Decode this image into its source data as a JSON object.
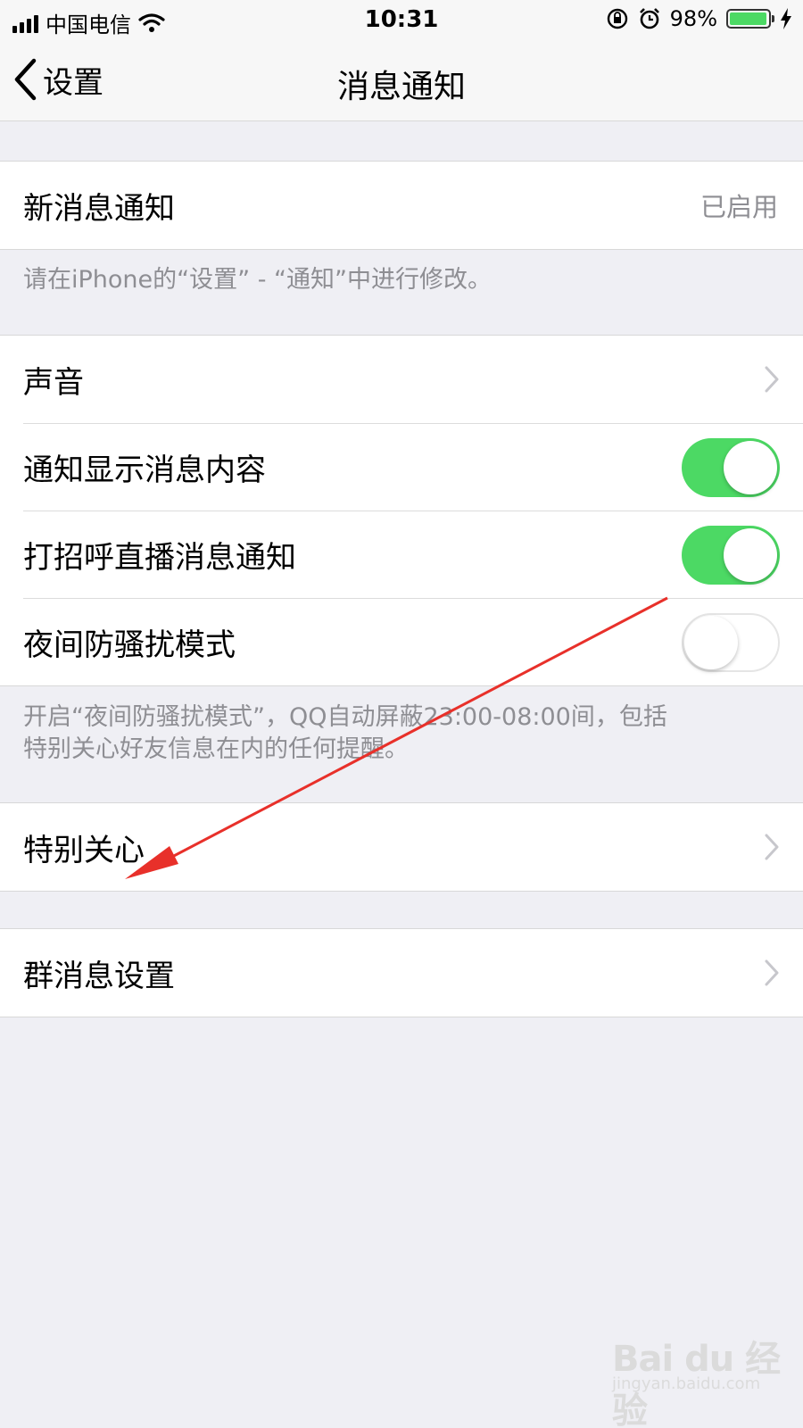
{
  "status_bar": {
    "carrier": "中国电信",
    "time": "10:31",
    "battery_percent": "98%",
    "battery_level": 0.98,
    "colors": {
      "battery_fill": "#4cd964"
    }
  },
  "nav": {
    "back_label": "设置",
    "title": "消息通知"
  },
  "new_message": {
    "label": "新消息通知",
    "value": "已启用",
    "note": "请在iPhone的“设置” - “通知”中进行修改。"
  },
  "settings": [
    {
      "label": "声音",
      "control": "chevron"
    },
    {
      "label": "通知显示消息内容",
      "control": "toggle",
      "on": true
    },
    {
      "label": "打招呼直播消息通知",
      "control": "toggle",
      "on": true
    },
    {
      "label": "夜间防骚扰模式",
      "control": "toggle",
      "on": false
    }
  ],
  "dnd_note": {
    "line1": "开启“夜间防骚扰模式”，QQ自动屏蔽23:00-08:00间，包括",
    "line2": "特别关心好友信息在内的任何提醒。"
  },
  "special_care": {
    "label": "特别关心"
  },
  "group_settings": {
    "label": "群消息设置"
  },
  "watermark": {
    "brand": "Bai du 经验",
    "url": "jingyan.baidu.com"
  },
  "colors": {
    "background": "#efeff4",
    "toggle_on": "#4cd964",
    "annotation_arrow": "#e8302a"
  }
}
